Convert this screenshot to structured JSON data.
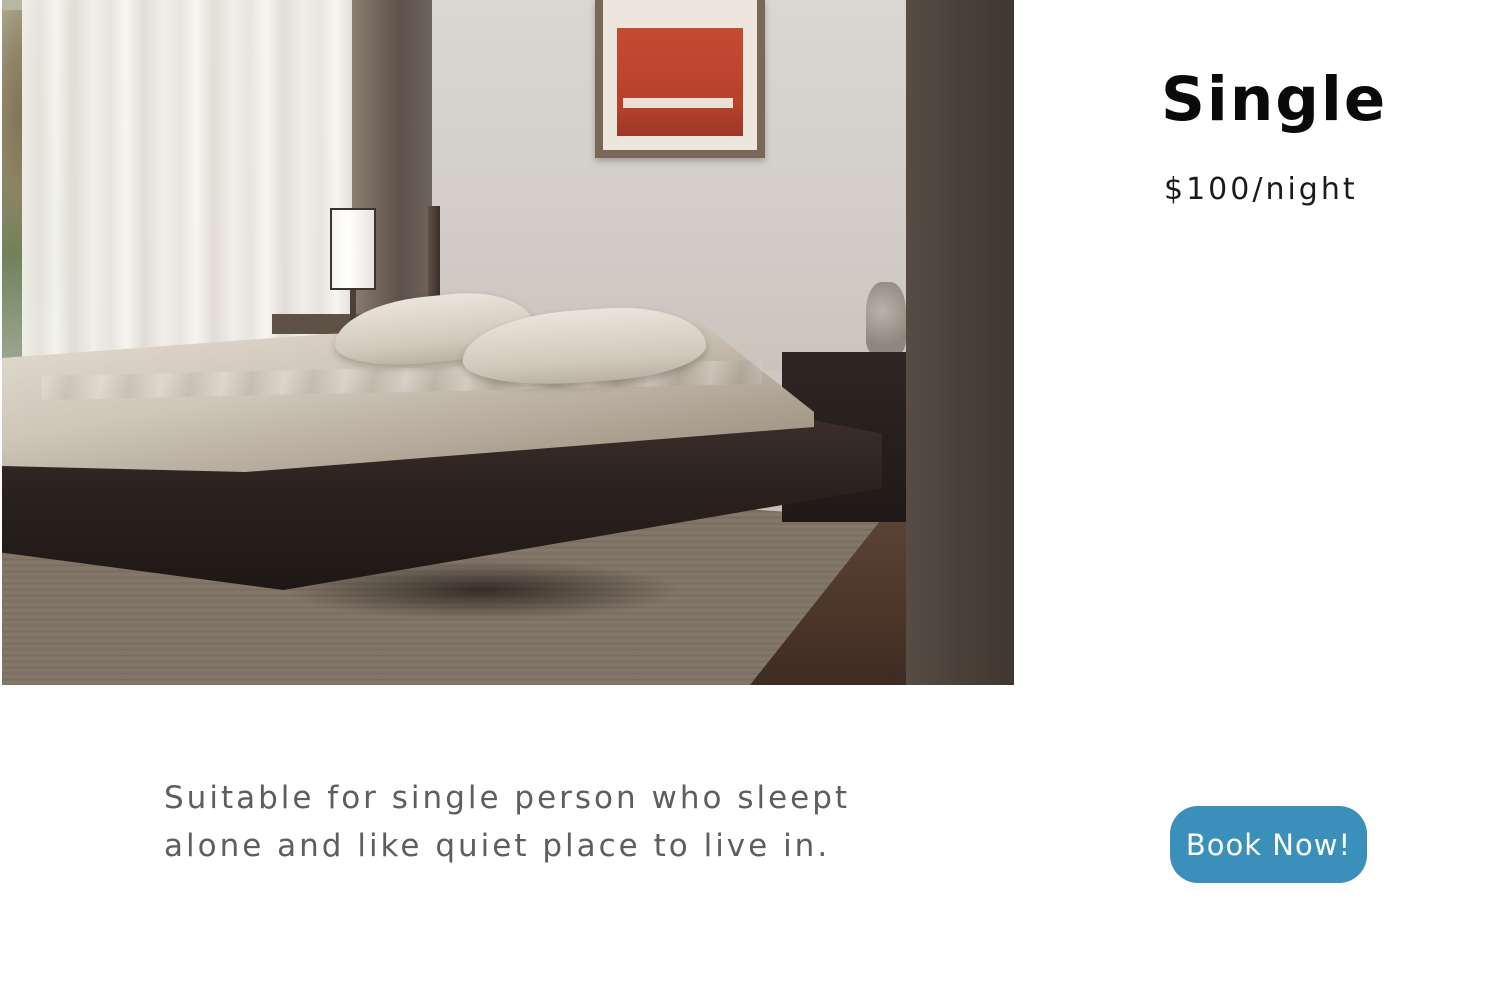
{
  "room": {
    "title": "Single",
    "price": "$100/night",
    "description": "Suitable for single person who sleept alone and like quiet place to live in.",
    "photo_icon": "bedroom-photo"
  },
  "actions": {
    "book_label": "Book Now!"
  },
  "colors": {
    "accent": "#3a8fbb",
    "title_text": "#0a0a0a",
    "body_text": "#5e5e5e",
    "background": "#ffffff"
  }
}
